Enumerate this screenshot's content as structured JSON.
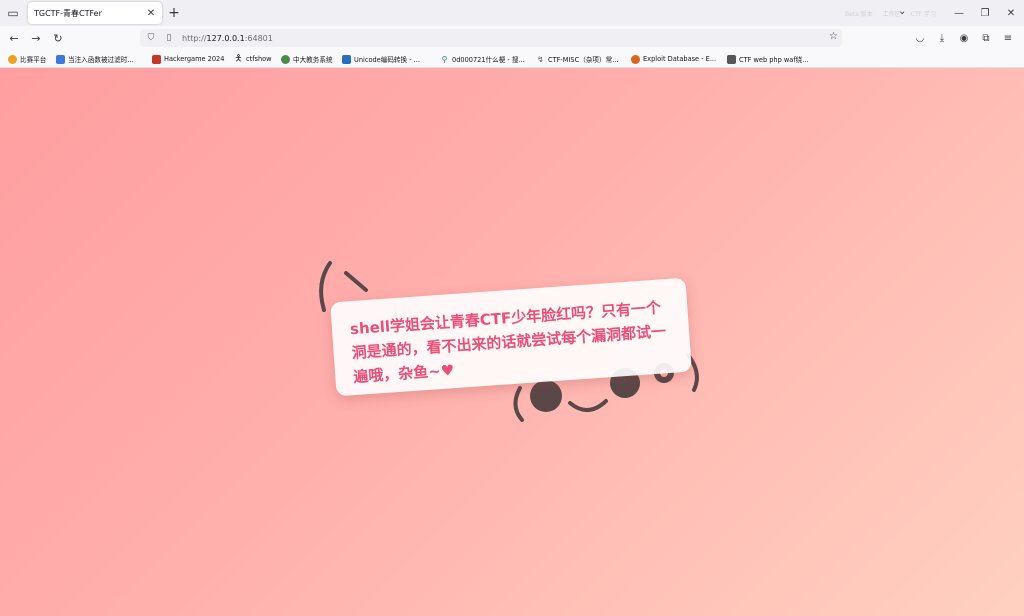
{
  "browser": {
    "tab_title": "TGCTF-青春CTFer",
    "url_prefix": "http://",
    "url_host": "127.0.0.1",
    "url_port": ":64801",
    "faint_labels": [
      "Beta 版本",
      "工作区",
      "CTF 学习"
    ]
  },
  "bookmarks": [
    {
      "label": "比赛平台",
      "icon": "orange-circle-icon",
      "color": "#f0a020"
    },
    {
      "label": "当注入函数被过滤时...",
      "icon": "blue-square-icon",
      "color": "#3b7ad8"
    },
    {
      "label": "Hackergame 2024",
      "icon": "hackergame-icon",
      "color": "#c0392b"
    },
    {
      "label": "ctfshow",
      "icon": "runner-icon",
      "color": "#333333"
    },
    {
      "label": "中大教务系统",
      "icon": "green-circle-icon",
      "color": "#4a8a4a"
    },
    {
      "label": "Unicode编码转换 - ...",
      "icon": "unicode-icon",
      "color": "#2a6ebb"
    },
    {
      "label": "0d000721什么梗 - 搜...",
      "icon": "search-icon",
      "color": "#2a6ebb"
    },
    {
      "label": "CTF-MISC（杂项）常...",
      "icon": "csdn-icon",
      "color": "#555555"
    },
    {
      "label": "Exploit Database - E...",
      "icon": "exploit-db-icon",
      "color": "#e0641b"
    },
    {
      "label": "CTF web php waf绕...",
      "icon": "cnblogs-icon",
      "color": "#555555"
    }
  ],
  "page": {
    "message": "shell学姐会让青春CTF少年脸红吗？只有一个洞是通的，看不出来的话就尝试每个漏洞都试一遍哦，杂鱼~♥"
  }
}
